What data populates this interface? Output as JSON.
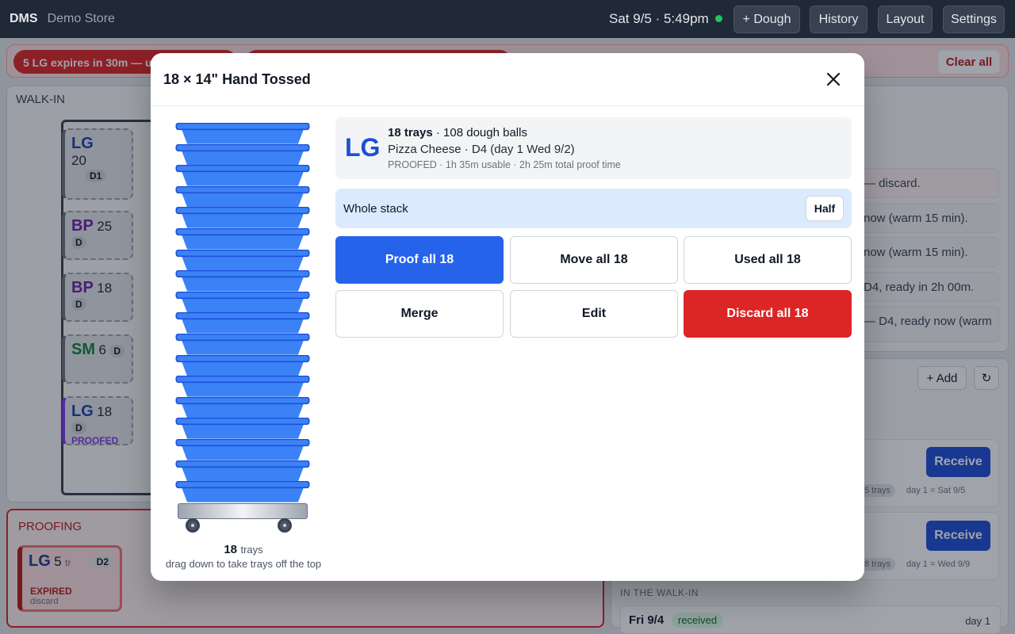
{
  "topbar": {
    "brand": "DMS",
    "store": "Demo Store",
    "clock": "Sat 9/5 · 5:49pm",
    "buttons": [
      "+ Dough",
      "History",
      "Layout",
      "Settings"
    ]
  },
  "alerts": {
    "first": "5 LG expires in 30m — us",
    "clear_all": "Clear all"
  },
  "walkin": {
    "title": "WALK-IN",
    "cards": [
      {
        "size": "LG",
        "count": "20",
        "badge": "D1",
        "size_color": "#1e40af"
      },
      {
        "size": "BP",
        "count": "25",
        "badge": "D",
        "size_color": "#6b21a8"
      },
      {
        "size": "BP",
        "count": "18",
        "badge": "D",
        "size_color": "#6b21a8"
      },
      {
        "size": "SM",
        "count": "6",
        "badge": "D",
        "size_color": "#15803d"
      },
      {
        "size": "LG",
        "count": "18",
        "badge": "D",
        "size_color": "#1e40af",
        "status": "PROOFED"
      }
    ]
  },
  "proofing": {
    "title": "PROOFING",
    "card": {
      "size": "LG",
      "count": "5",
      "unit": "tr",
      "badge": "D2",
      "status": "EXPIRED",
      "note": "discard"
    }
  },
  "right_messages": [
    "— discard.",
    "now (warm 15 min).",
    "now (warm 15 min).",
    "D4, ready in 2h 00m.",
    "— D4, ready now (warm"
  ],
  "orders": {
    "add": "+ Add",
    "refresh_icon": "↻",
    "receive": "Receive",
    "rows": [
      {
        "trays": "5 trays",
        "day": "day 1 = Sat 9/5"
      },
      {
        "trays": "8 trays",
        "day": "day 1 = Wed 9/9"
      }
    ],
    "inwalk_title": "IN THE WALK-IN",
    "walk_row": {
      "date": "Fri 9/4",
      "status": "received",
      "day": "day 1"
    }
  },
  "modal": {
    "title": "18 × 14\" Hand Tossed",
    "close_icon": "close-icon",
    "info": {
      "size": "LG",
      "trays": "18 trays",
      "balls": " · 108 dough balls",
      "line2": "Pizza Cheese · D4 (day 1 Wed 9/2)",
      "line3": "PROOFED · 1h 35m usable · 2h 25m total proof time"
    },
    "stack": {
      "tray_count": 18,
      "count_text": "18",
      "unit": "trays",
      "hint": "drag down to take trays off the top",
      "tray_color": "#3b82f6",
      "rim_color": "#1d4ed8"
    },
    "whole": {
      "label": "Whole stack",
      "half": "Half"
    },
    "actions": {
      "proof": "Proof all 18",
      "move": "Move all 18",
      "used": "Used all 18",
      "merge": "Merge",
      "edit": "Edit",
      "discard": "Discard all 18"
    },
    "colors": {
      "primary": "#2563eb",
      "danger": "#dc2626"
    }
  }
}
